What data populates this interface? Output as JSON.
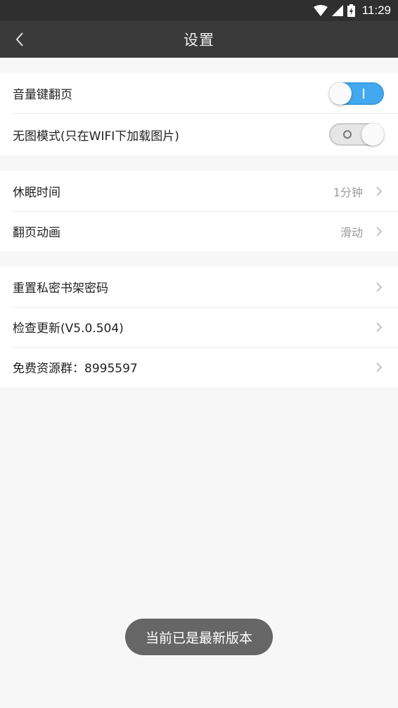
{
  "status_bar": {
    "time": "11:29"
  },
  "app_bar": {
    "title": "设置"
  },
  "groups": [
    {
      "items": [
        {
          "label": "音量键翻页",
          "type": "switch",
          "state": "on"
        },
        {
          "label": "无图模式(只在WIFI下加载图片)",
          "type": "switch",
          "state": "off"
        }
      ]
    },
    {
      "items": [
        {
          "label": "休眠时间",
          "value": "1分钟"
        },
        {
          "label": "翻页动画",
          "value": "滑动"
        }
      ]
    },
    {
      "items": [
        {
          "label": "重置私密书架密码"
        },
        {
          "label": "检查更新(V5.0.504)"
        },
        {
          "label": "免费资源群：8995597"
        }
      ]
    }
  ],
  "toast": {
    "message": "当前已是最新版本"
  },
  "colors": {
    "app_bar": "#3a3a3a",
    "switch_on": "#42a9f0",
    "background": "#f7f7f7"
  }
}
